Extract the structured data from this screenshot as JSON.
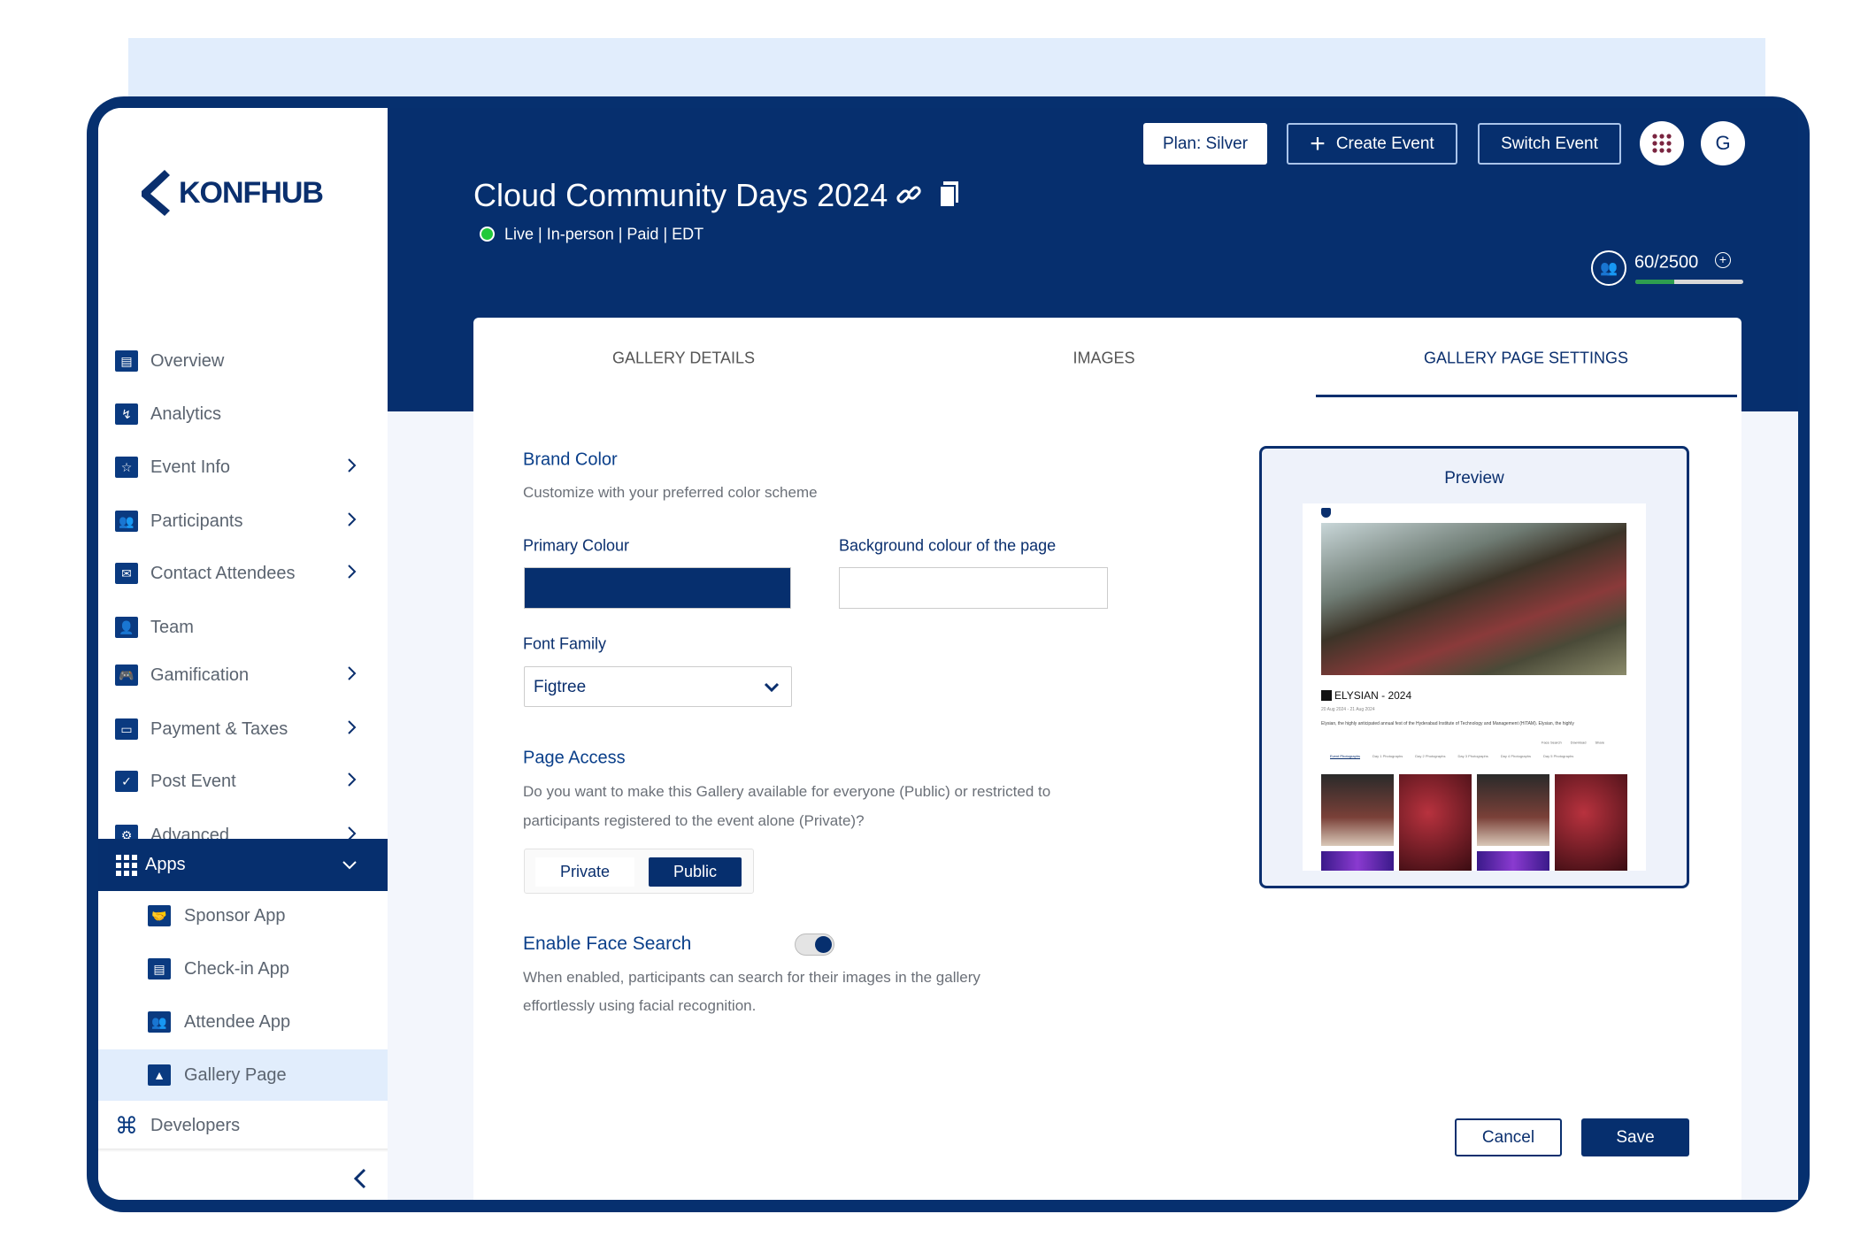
{
  "brand": {
    "logo_text": "KONFHUB",
    "color": "#06306f"
  },
  "header": {
    "event_title": "Cloud Community Days 2024",
    "status": "Live | In-person | Paid | EDT",
    "status_color": "#22c93a",
    "plan_label": "Plan: Silver",
    "create_event_label": "Create Event",
    "switch_event_label": "Switch Event",
    "avatar_initial": "G",
    "attendee_count": "60/2500",
    "attendee_progress": 0.36
  },
  "sidebar": {
    "items": [
      {
        "label": "Overview",
        "icon": "document-search-icon",
        "chevron": ""
      },
      {
        "label": "Analytics",
        "icon": "chart-line-icon",
        "chevron": ""
      },
      {
        "label": "Event Info",
        "icon": "calendar-star-icon",
        "chevron": ">"
      },
      {
        "label": "Participants",
        "icon": "users-icon",
        "chevron": ">"
      },
      {
        "label": "Contact Attendees",
        "icon": "mail-phone-icon",
        "chevron": ">"
      },
      {
        "label": "Team",
        "icon": "user-plus-icon",
        "chevron": ""
      },
      {
        "label": "Gamification",
        "icon": "gamepad-icon",
        "chevron": ">"
      },
      {
        "label": "Payment & Taxes",
        "icon": "payment-card-icon",
        "chevron": ">"
      },
      {
        "label": "Post Event",
        "icon": "calendar-check-icon",
        "chevron": ">"
      },
      {
        "label": "Advanced",
        "icon": "gear-icon",
        "chevron": ">"
      }
    ],
    "apps": {
      "label": "Apps",
      "chevron": "v"
    },
    "sub_items": [
      {
        "label": "Sponsor App",
        "icon": "handshake-icon"
      },
      {
        "label": "Check-in App",
        "icon": "badge-check-icon"
      },
      {
        "label": "Attendee App",
        "icon": "users-icon"
      },
      {
        "label": "Gallery Page",
        "icon": "image-icon"
      }
    ],
    "developers": {
      "label": "Developers",
      "icon": "developers-icon"
    },
    "collapse": "<"
  },
  "tabs": [
    {
      "label": "GALLERY DETAILS",
      "active": false
    },
    {
      "label": "IMAGES",
      "active": false
    },
    {
      "label": "GALLERY PAGE SETTINGS",
      "active": true
    }
  ],
  "form": {
    "brand_title": "Brand Color",
    "brand_desc": "Customize with your preferred color scheme",
    "primary_label": "Primary Colour",
    "primary_value": "#062f6e",
    "bg_label": "Background colour of the page",
    "bg_value": "#ffffff",
    "font_label": "Font Family",
    "font_value": "Figtree",
    "access_title": "Page Access",
    "access_desc_1": "Do you want to make this Gallery available for everyone (Public) or restricted to",
    "access_desc_2": "participants registered to the event alone (Private)?",
    "access_options": [
      "Private",
      "Public"
    ],
    "access_selected": "Public",
    "face_title": "Enable Face Search",
    "face_enabled": true,
    "face_desc_1": "When enabled, participants can search for their images in the gallery",
    "face_desc_2": "effortlessly using facial recognition."
  },
  "preview": {
    "title": "Preview",
    "event_name": "ELYSIAN - 2024",
    "dates": "20 Aug 2024 - 21 Aug 2024",
    "description": "Elysian, the highly anticipated annual fest of the Hyderabad Institute of Technology and Management (HITAM). Elysian, the highly",
    "actions": [
      "Face Search",
      "Download",
      "Share"
    ],
    "tabs": [
      "Event Photographs",
      "Day 1 Photographs",
      "Day 2 Photographs",
      "Day 3 Photographs",
      "Day 4 Photographs",
      "Day 5 Photographs"
    ]
  },
  "footer": {
    "cancel_label": "Cancel",
    "save_label": "Save"
  }
}
